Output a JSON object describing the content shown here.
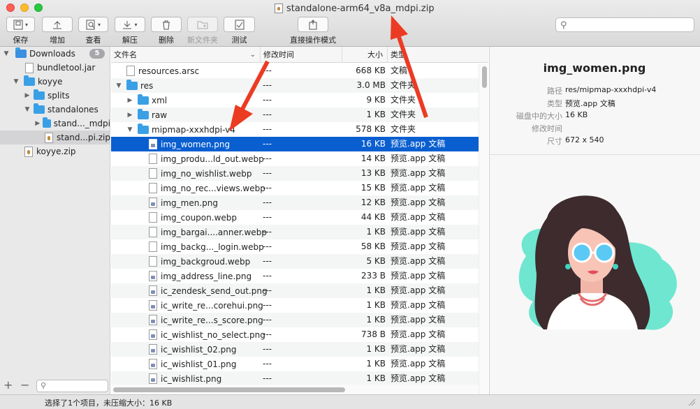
{
  "window": {
    "title": "standalone-arm64_v8a_mdpi.zip"
  },
  "toolbar": {
    "buttons": [
      {
        "label": "保存",
        "icon": "save-icon"
      },
      {
        "label": "增加",
        "icon": "add-icon"
      },
      {
        "label": "查看",
        "icon": "view-icon"
      },
      {
        "label": "解压",
        "icon": "extract-icon"
      },
      {
        "label": "删除",
        "icon": "delete-icon"
      },
      {
        "label": "新文件夹",
        "icon": "new-folder-icon"
      },
      {
        "label": "测试",
        "icon": "test-icon"
      },
      {
        "label": "直接操作模式",
        "icon": "direct-mode-icon"
      }
    ],
    "search_placeholder": ""
  },
  "sidebar": {
    "items": [
      {
        "label": "Downloads",
        "badge": "5",
        "icon": "downloads-folder-icon"
      },
      {
        "label": "bundletool.jar",
        "icon": "jar-file-icon"
      },
      {
        "label": "koyye",
        "icon": "folder-icon"
      },
      {
        "label": "splits",
        "icon": "folder-icon"
      },
      {
        "label": "standalones",
        "icon": "folder-icon"
      },
      {
        "label": "stand..._mdpi",
        "icon": "folder-icon"
      },
      {
        "label": "stand...pi.zip",
        "icon": "zip-file-icon"
      },
      {
        "label": "koyye.zip",
        "icon": "zip-file-icon"
      }
    ],
    "filter_placeholder": ""
  },
  "list": {
    "columns": {
      "name": "文件名",
      "date": "修改时间",
      "size": "大小",
      "kind": "类型"
    },
    "rows": [
      {
        "name": "resources.arsc",
        "date": "---",
        "size": "668 KB",
        "kind": "文稿"
      },
      {
        "name": "res",
        "date": "---",
        "size": "3.0 MB",
        "kind": "文件夹"
      },
      {
        "name": "xml",
        "date": "---",
        "size": "9 KB",
        "kind": "文件夹"
      },
      {
        "name": "raw",
        "date": "---",
        "size": "1 KB",
        "kind": "文件夹"
      },
      {
        "name": "mipmap-xxxhdpi-v4",
        "date": "---",
        "size": "578 KB",
        "kind": "文件夹"
      },
      {
        "name": "img_women.png",
        "date": "---",
        "size": "16 KB",
        "kind": "预览.app 文稿"
      },
      {
        "name": "img_produ...ld_out.webp",
        "date": "---",
        "size": "14 KB",
        "kind": "预览.app 文稿"
      },
      {
        "name": "img_no_wishlist.webp",
        "date": "---",
        "size": "13 KB",
        "kind": "预览.app 文稿"
      },
      {
        "name": "img_no_rec...views.webp",
        "date": "---",
        "size": "15 KB",
        "kind": "预览.app 文稿"
      },
      {
        "name": "img_men.png",
        "date": "---",
        "size": "12 KB",
        "kind": "预览.app 文稿"
      },
      {
        "name": "img_coupon.webp",
        "date": "---",
        "size": "44 KB",
        "kind": "预览.app 文稿"
      },
      {
        "name": "img_bargai....anner.webp",
        "date": "---",
        "size": "1 KB",
        "kind": "预览.app 文稿"
      },
      {
        "name": "img_backg..._login.webp",
        "date": "---",
        "size": "58 KB",
        "kind": "预览.app 文稿"
      },
      {
        "name": "img_backgroud.webp",
        "date": "---",
        "size": "5 KB",
        "kind": "预览.app 文稿"
      },
      {
        "name": "img_address_line.png",
        "date": "---",
        "size": "233 B",
        "kind": "预览.app 文稿"
      },
      {
        "name": "ic_zendesk_send_out.png",
        "date": "---",
        "size": "1 KB",
        "kind": "预览.app 文稿"
      },
      {
        "name": "ic_write_re...corehui.png",
        "date": "---",
        "size": "1 KB",
        "kind": "预览.app 文稿"
      },
      {
        "name": "ic_write_re...s_score.png",
        "date": "---",
        "size": "1 KB",
        "kind": "预览.app 文稿"
      },
      {
        "name": "ic_wishlist_no_select.png",
        "date": "---",
        "size": "738 B",
        "kind": "预览.app 文稿"
      },
      {
        "name": "ic_wishlist_02.png",
        "date": "---",
        "size": "1 KB",
        "kind": "预览.app 文稿"
      },
      {
        "name": "ic_wishlist_01.png",
        "date": "---",
        "size": "1 KB",
        "kind": "预览.app 文稿"
      },
      {
        "name": "ic_wishlist.png",
        "date": "---",
        "size": "1 KB",
        "kind": "预览.app 文稿"
      }
    ]
  },
  "inspector": {
    "title": "img_women.png",
    "fields": [
      {
        "key": "路径",
        "value": "res/mipmap-xxxhdpi-v4"
      },
      {
        "key": "类型",
        "value": "预览.app 文稿"
      },
      {
        "key": "磁盘中的大小",
        "value": "16 KB"
      },
      {
        "key": "修改时间",
        "value": ""
      },
      {
        "key": "尺寸",
        "value": "672 x 540"
      }
    ]
  },
  "status": {
    "text": "选择了1个项目，未压缩大小：16 KB"
  },
  "colors": {
    "selection": "#0a5fd0",
    "folder": "#3aa0e6",
    "annotation_arrow": "#ec3b23"
  }
}
